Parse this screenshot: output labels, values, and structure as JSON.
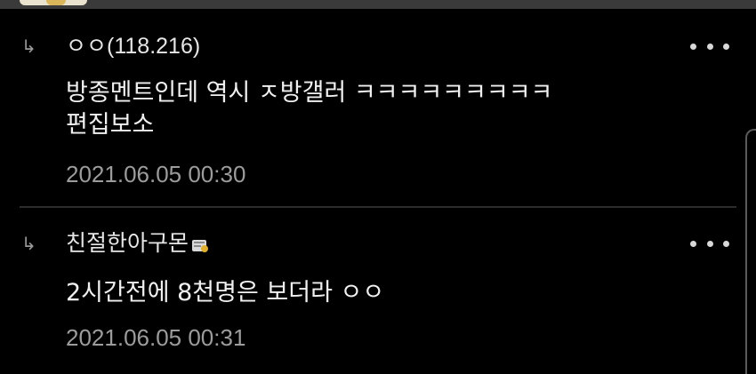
{
  "comments": [
    {
      "reply_icon": "reply-arrow-icon",
      "author": "ㅇㅇ",
      "ip": "(118.216)",
      "badge": null,
      "lines": [
        "방종멘트인데 역시 ㅈ방갤러 ㅋㅋㅋㅋㅋㅋㅋㅋㅋ",
        "편집보소"
      ],
      "date": "2021.06.05 00:30"
    },
    {
      "reply_icon": "reply-arrow-icon",
      "author": "친절한아구몬",
      "ip": "",
      "badge": "fixed-nick-badge-icon",
      "lines": [
        "2시간전에 8천명은 보더라 ㅇㅇ"
      ],
      "date": "2021.06.05 00:31"
    }
  ],
  "colors": {
    "background": "#000000",
    "text": "#f0f0f0",
    "muted": "#9c9c9c",
    "divider": "#2c2c2c"
  }
}
